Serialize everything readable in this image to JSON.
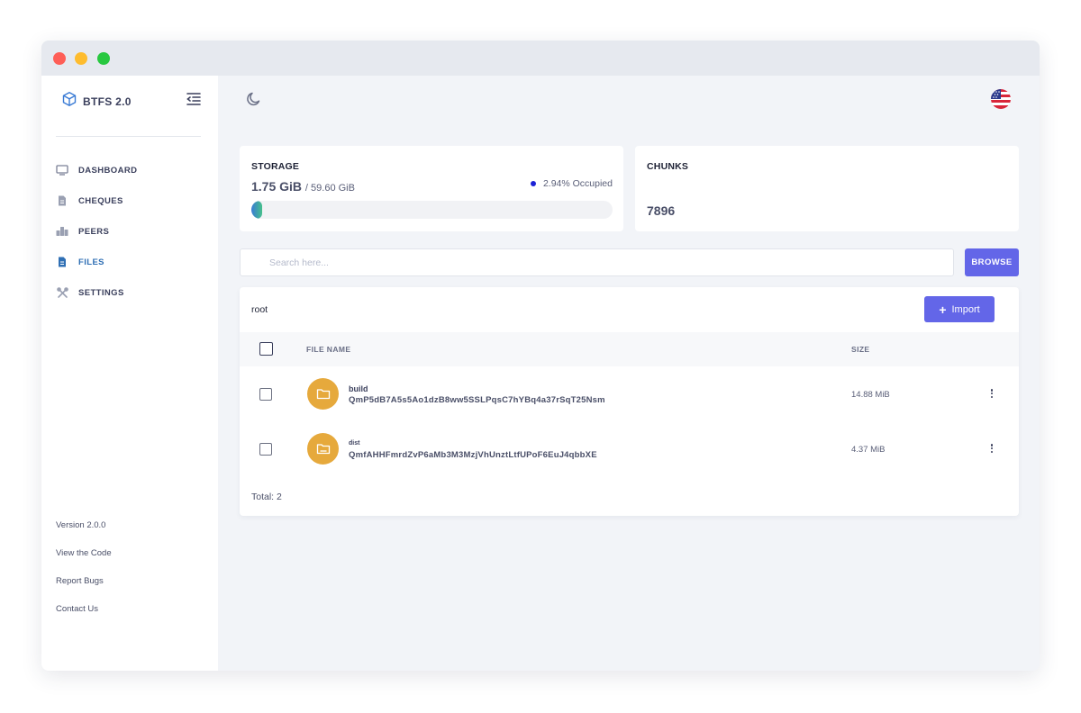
{
  "app": {
    "name": "BTFS 2.0"
  },
  "sidebar": {
    "items": [
      {
        "label": "DASHBOARD",
        "icon": "monitor-icon",
        "active": false
      },
      {
        "label": "CHEQUES",
        "icon": "document-icon",
        "active": false
      },
      {
        "label": "PEERS",
        "icon": "peers-icon",
        "active": false
      },
      {
        "label": "FILES",
        "icon": "file-icon",
        "active": true
      },
      {
        "label": "SETTINGS",
        "icon": "tools-icon",
        "active": false
      }
    ],
    "footer_links": [
      "Version 2.0.0",
      "View the Code",
      "Report Bugs",
      "Contact Us"
    ]
  },
  "storage": {
    "title": "STORAGE",
    "used": "1.75 GiB",
    "total": "/ 59.60 GiB",
    "occupied_label": "2.94% Occupied",
    "occupied_fraction": 0.0294
  },
  "chunks": {
    "title": "CHUNKS",
    "value": "7896"
  },
  "search": {
    "placeholder": "Search here..."
  },
  "browse": {
    "label": "BROWSE"
  },
  "files": {
    "path": "root",
    "import_label": "Import",
    "columns": {
      "name": "FILE NAME",
      "size": "SIZE"
    },
    "rows": [
      {
        "name": "build",
        "hash": "QmP5dB7A5s5Ao1dzB8ww5SSLPqsC7hYBq4a37rSqT25Nsm",
        "size": "14.88 MiB"
      },
      {
        "name": "dist",
        "hash": "QmfAHHFmrdZvP6aMb3M3MzjVhUnztLtfUPoF6EuJ4qbbXE",
        "size": "4.37 MiB"
      }
    ],
    "total": "Total: 2"
  },
  "colors": {
    "accent": "#6366e8",
    "active_nav": "#2f6fb4",
    "folder": "#e6a93c",
    "occupied_dot": "#1c22d6"
  }
}
